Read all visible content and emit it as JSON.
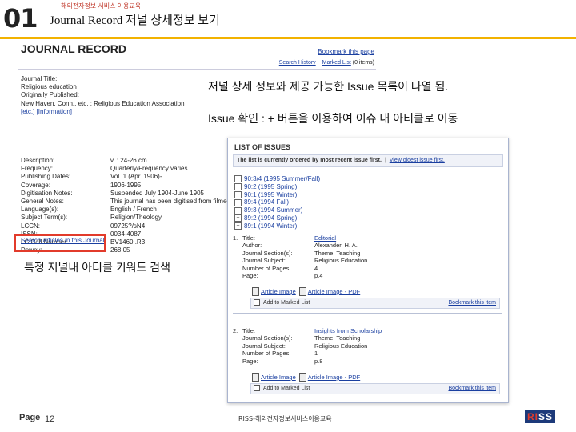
{
  "header": {
    "number": "01",
    "subtitle": "해외전자정보 서비스 이용교육",
    "title": "Journal Record 저널 상세정보 보기"
  },
  "journal_record": {
    "title": "JOURNAL RECORD",
    "bookmark_link": "Bookmark this page",
    "search_history_link": "Search History",
    "marked_list_link": "Marked List",
    "marked_list_count": "(0 items)",
    "fields": [
      "Journal Title:",
      "Religious education",
      "Originally Published:",
      "New Haven, Conn., etc. : Religious Education Association",
      "[etc.] [Information]"
    ],
    "details": [
      {
        "label": "Description:",
        "value": "v. : 24-26 cm."
      },
      {
        "label": "Frequency:",
        "value": "Quarterly/Frequency varies"
      },
      {
        "label": "Publishing Dates:",
        "value": "Vol. 1 (Apr. 1906)-"
      },
      {
        "label": "Coverage:",
        "value": "1906-1995"
      },
      {
        "label": "Digitisation Notes:",
        "value": "Suspended July 1904-June 1905"
      },
      {
        "label": "General Notes:",
        "value": "This journal has been digitised from filmed"
      },
      {
        "label": "Language(s):",
        "value": "English / French"
      },
      {
        "label": "Subject Term(s):",
        "value": "Religion/Theology"
      },
      {
        "label": "LCCN:",
        "value": "09725?/sN4"
      },
      {
        "label": "ISSN:",
        "value": "0034-4087"
      },
      {
        "label": "LC Call Number:",
        "value": "BV1460 .R3"
      },
      {
        "label": "Dewey:",
        "value": "268.05"
      }
    ],
    "search_link": "Search articles in this Journal"
  },
  "callouts": {
    "c1": "저널 상세 정보와 제공 가능한 Issue 목록이 나열 됨.",
    "c2": "Issue 확인 : + 버튼을 이용하여 이슈 내 아티클로 이동",
    "c3": "특정 저널내 아티클 키워드 검색"
  },
  "list_of_issues": {
    "title": "LIST OF ISSUES",
    "note": "The list is currently ordered by most recent issue first.",
    "oldest_link": "View oldest issue first.",
    "issues": [
      "90:3/4 (1995 Summer/Fall)",
      "90:2 (1995 Spring)",
      "90:1 (1995 Winter)",
      "89:4 (1994 Fall)",
      "89:3 (1994 Summer)",
      "89:2 (1994 Spring)",
      "89:1 (1994 Winter)"
    ],
    "articles": [
      {
        "num": "1.",
        "rows": [
          {
            "label": "Title:",
            "value": "Editorial"
          },
          {
            "label": "Author:",
            "value": "Alexander, H. A."
          },
          {
            "label": "Journal Section(s):",
            "value": "Theme: Teaching"
          },
          {
            "label": "Journal Subject:",
            "value": "Religious Education"
          },
          {
            "label": "Number of Pages:",
            "value": "4"
          },
          {
            "label": "Page:",
            "value": "p.4"
          }
        ],
        "image_link": "Article Image",
        "pdf_link": "Article Image - PDF",
        "marked_label": "Add to Marked List",
        "bookmark": "Bookmark this item"
      },
      {
        "num": "2.",
        "rows": [
          {
            "label": "Title:",
            "value": "Insights from Scholarship"
          },
          {
            "label": "Journal Section(s):",
            "value": "Theme: Teaching"
          },
          {
            "label": "Journal Subject:",
            "value": "Religious Education"
          },
          {
            "label": "Number of Pages:",
            "value": "1"
          },
          {
            "label": "Page:",
            "value": "p.8"
          }
        ],
        "image_link": "Article Image",
        "pdf_link": "Article Image - PDF",
        "marked_label": "Add to Marked List",
        "bookmark": "Bookmark this item"
      }
    ]
  },
  "footer": {
    "page_label": "Page",
    "page_number": "12",
    "center": "RISS-해외전자정보서비스이용교육",
    "logo_a": "RI",
    "logo_b": "SS"
  },
  "colors": {
    "accent_bar": "#f2b200",
    "highlight_box": "#e23b2b",
    "link": "#1a3fa0"
  }
}
